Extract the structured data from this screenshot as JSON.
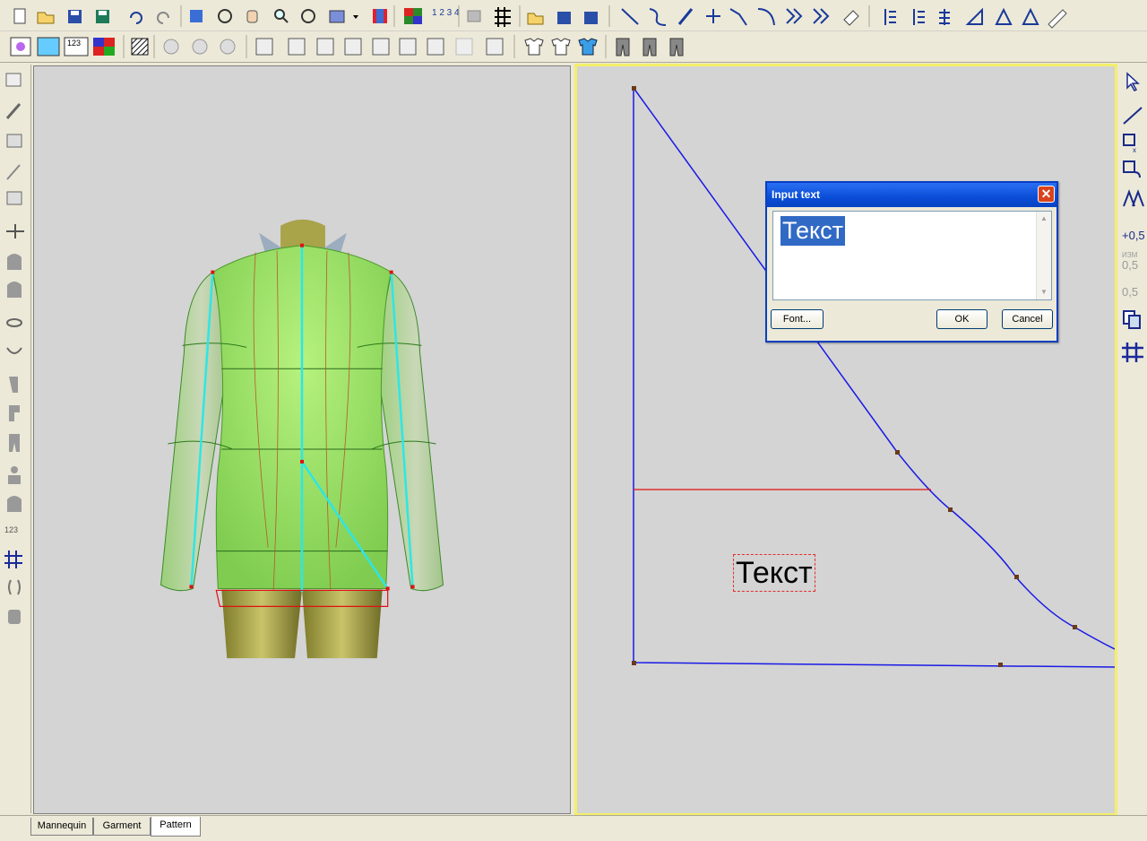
{
  "toolbar_top": {
    "icons": [
      "new-icon",
      "open-icon",
      "save-icon",
      "save-all-icon",
      "undo-icon",
      "redo-icon",
      "view-icon",
      "rotate-icon",
      "hand-icon",
      "zoom-icon",
      "zoom-fit-icon",
      "render-icon",
      "dropdown-icon",
      "texture-icon",
      "color-grid-icon",
      "numbering-icon",
      "flag-icon",
      "grid-icon",
      "open-tp-icon",
      "save-tp-icon",
      "save-tp2-icon",
      "line-icon",
      "curve-icon",
      "pencil-icon",
      "point-icon",
      "angle-icon",
      "arc-icon",
      "chain-icon",
      "chain2-icon",
      "eraser-icon",
      "align-icon",
      "spacing-icon",
      "distribute-icon",
      "measure-angle-icon",
      "triangle-icon",
      "triangle2-icon",
      "ruler-icon"
    ],
    "numbering_label": "1 2 3 4"
  },
  "toolbar_second": {
    "icons": [
      "mannequin-view-icon",
      "garment-view-icon",
      "size-table-icon",
      "fabric-icon",
      "hatch-icon",
      "seam-icon",
      "seam2-icon",
      "seam3-icon",
      "pattern-icon",
      "pattern2-icon",
      "pattern3-icon",
      "pattern4-icon",
      "pattern5-icon",
      "pattern6-icon",
      "pattern7-icon",
      "pattern8-icon",
      "pattern9-icon",
      "shirt-outline-icon",
      "shirt-outline2-icon",
      "shirt-filled-icon",
      "pants-icon",
      "pants2-icon",
      "pants3-icon"
    ],
    "size_table_label": "123"
  },
  "left_toolbar": {
    "icons": [
      "select-piece-icon",
      "brush-icon",
      "layers-icon",
      "needle-icon",
      "shape-icon",
      "mirror-icon",
      "torso-icon",
      "torso2-icon",
      "ring-icon",
      "collar-icon",
      "sleeve-icon",
      "sleeve2-icon",
      "leg-icon",
      "mannequin-icon",
      "mannequin2-icon",
      "measure-icon",
      "grid-icon",
      "symmetry-icon",
      "hand-tool-icon"
    ],
    "measure_label": "123"
  },
  "right_toolbar": {
    "icons": [
      "pointer-icon",
      "line-tool-icon",
      "scale-x-icon",
      "rotate-piece-icon",
      "mirror-piece-icon",
      "plus-half-icon",
      "izm-half-icon",
      "cut-half-icon",
      "copy-icon",
      "grid-icon"
    ],
    "plus_half_label": "+0,5",
    "izm_label": "ИЗМ",
    "izm_value": "0,5",
    "cut_value": "0,5"
  },
  "canvas": {
    "label_text": "Текст"
  },
  "dialog": {
    "title": "Input text",
    "text_value": "Текст",
    "font_button": "Font...",
    "ok_button": "OK",
    "cancel_button": "Cancel"
  },
  "tabs": [
    {
      "label": "Mannequin",
      "active": false
    },
    {
      "label": "Garment",
      "active": false
    },
    {
      "label": "Pattern",
      "active": true
    }
  ],
  "colors": {
    "garment_fill": "#93e065",
    "outline_blue": "#1a1ae6",
    "construction_red": "#e01010",
    "selection": "#316ac5",
    "view_border": "#f4ef6a"
  }
}
